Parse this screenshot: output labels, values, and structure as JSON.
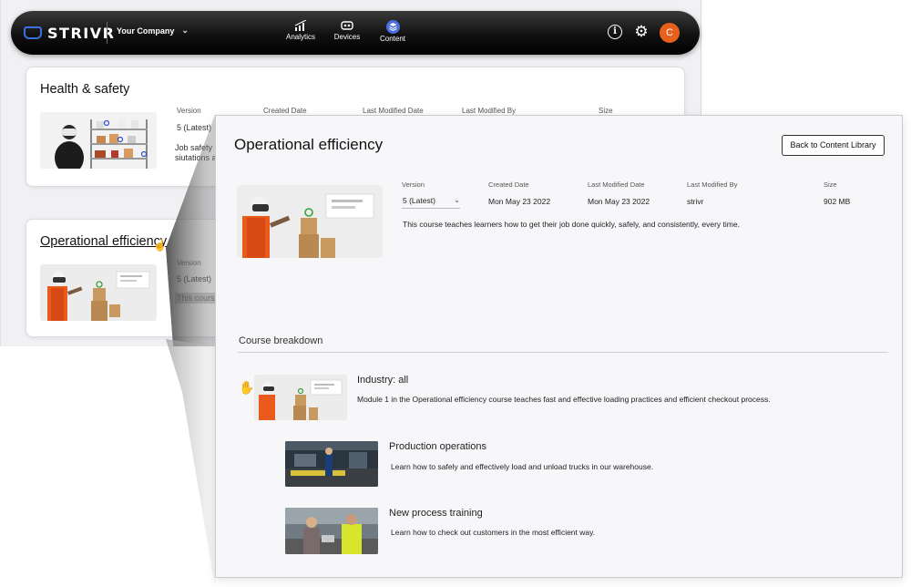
{
  "app": {
    "brand": "STRIVR",
    "company": "Your Company",
    "nav": [
      {
        "label": "Analytics",
        "icon": "analytics-icon"
      },
      {
        "label": "Devices",
        "icon": "devices-icon"
      },
      {
        "label": "Content",
        "icon": "content-icon"
      }
    ],
    "avatar_initial": "C",
    "accent_color": "#3b6fe0",
    "avatar_color": "#e8611c"
  },
  "library": {
    "columns": [
      "Version",
      "Created Date",
      "Last Modified Date",
      "Last Modified By",
      "Size"
    ],
    "cards": [
      {
        "title": "Health & safety",
        "version": "5 (Latest)",
        "desc_line1": "Job safety",
        "desc_line2": "siutations a"
      },
      {
        "title": "Operational efficiency",
        "col_label": "Version",
        "version": "5 (Latest)",
        "desc": "This cours"
      }
    ]
  },
  "detail": {
    "title": "Operational efficiency",
    "back_label": "Back to Content Library",
    "columns": [
      "Version",
      "Created Date",
      "Last Modified Date",
      "Last Modified By",
      "Size"
    ],
    "version": "5 (Latest)",
    "created": "Mon May 23 2022",
    "modified": "Mon May 23 2022",
    "modified_by": "strivr",
    "size": "902 MB",
    "description": "This course teaches learners how to get their job done quickly, safely, and consistently, every time.",
    "breakdown_title": "Course breakdown",
    "modules": [
      {
        "title": "Industry: all",
        "desc": "Module 1 in the Operational efficiency course teaches fast and effective loading practices and efficient checkout process."
      },
      {
        "title": "Production operations",
        "desc": "Learn how to safely and effectively load and unload trucks in our warehouse."
      },
      {
        "title": "New process training",
        "desc": "Learn how to check out customers in the most efficient way."
      }
    ]
  }
}
